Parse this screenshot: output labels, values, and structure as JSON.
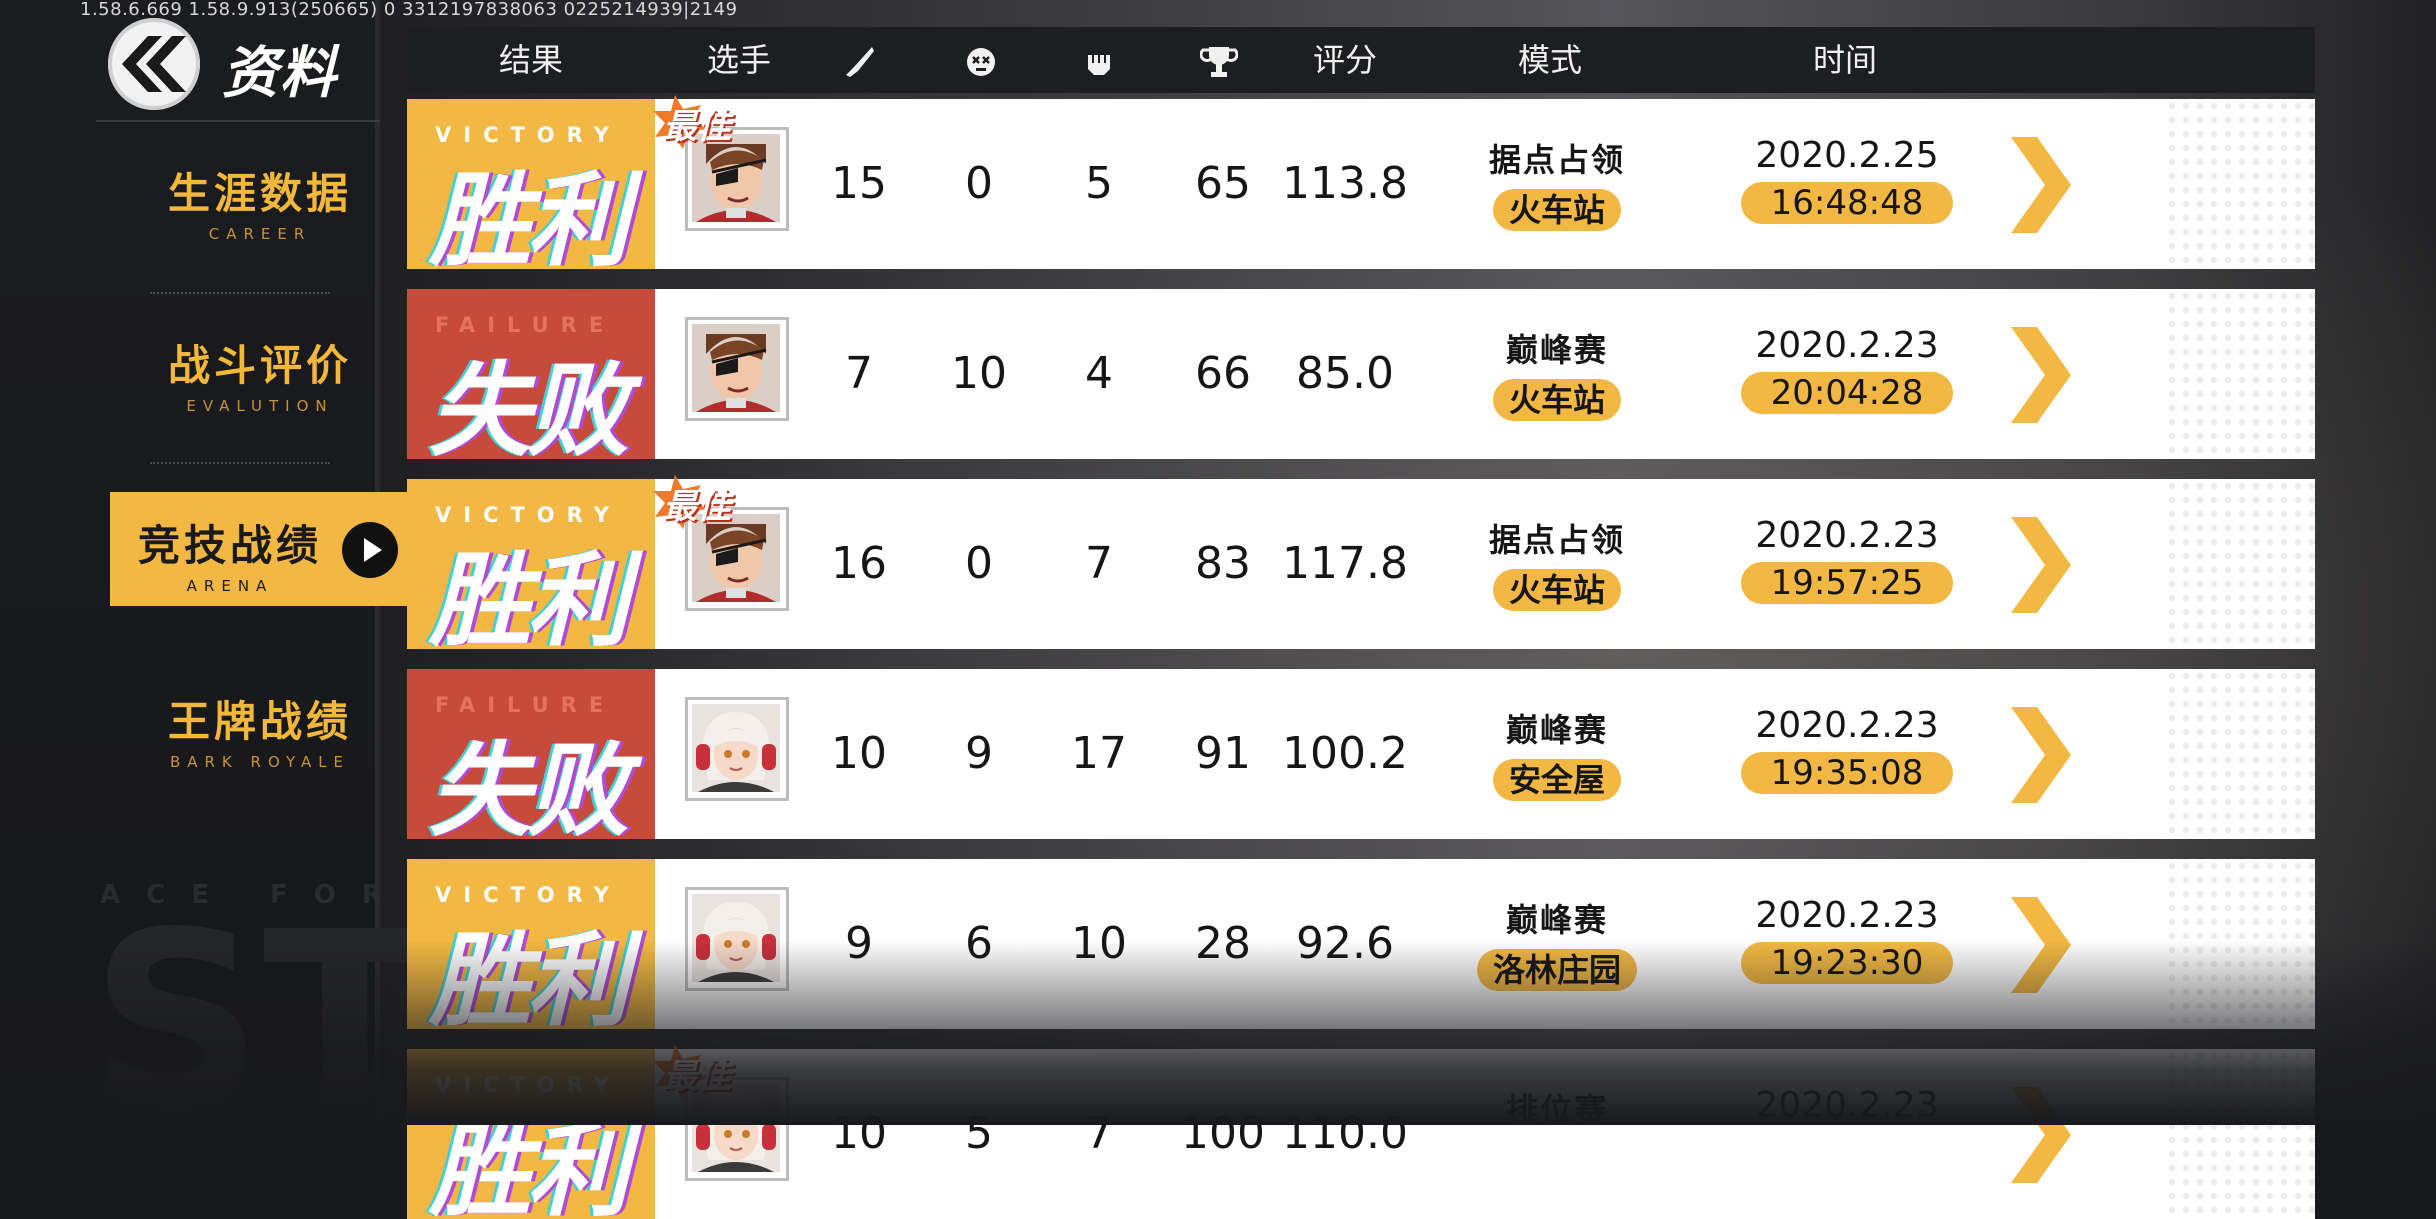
{
  "debug_text": "1.58.6.669 1.58.9.913(250665) 0 3312197838063   0225214939|2149",
  "app": {
    "title": "资料",
    "back_icon": "double-chevron-left-icon"
  },
  "sidebar": {
    "items": [
      {
        "label": "生涯数据",
        "sub": "CAREER",
        "active": false
      },
      {
        "label": "战斗评价",
        "sub": "EVALUTION",
        "active": false
      },
      {
        "label": "竞技战绩",
        "sub": "ARENA",
        "active": true
      },
      {
        "label": "王牌战绩",
        "sub": "BARK ROYALE",
        "active": false
      }
    ],
    "watermark_sub": "ACE FORCE",
    "watermark_big": "ST"
  },
  "table": {
    "headers": {
      "result": "结果",
      "player": "选手",
      "kills_icon": "knife-icon",
      "deaths_icon": "skull-icon",
      "assists_icon": "fist-icon",
      "points_icon": "trophy-icon",
      "score": "评分",
      "mode": "模式",
      "time": "时间"
    },
    "best_badge": "最佳",
    "rows": [
      {
        "result": "win",
        "result_en": "VICTORY",
        "result_cn": "胜利",
        "best": true,
        "avatar": "eyepatch-hero",
        "kills": "15",
        "deaths": "0",
        "assists": "5",
        "points": "65",
        "score": "113.8",
        "mode": "据点占领",
        "map": "火车站",
        "date": "2020.2.25",
        "time": "16:48:48"
      },
      {
        "result": "lose",
        "result_en": "FAILURE",
        "result_cn": "失败",
        "best": false,
        "avatar": "eyepatch-hero",
        "kills": "7",
        "deaths": "10",
        "assists": "4",
        "points": "66",
        "score": "85.0",
        "mode": "巅峰赛",
        "map": "火车站",
        "date": "2020.2.23",
        "time": "20:04:28"
      },
      {
        "result": "win",
        "result_en": "VICTORY",
        "result_cn": "胜利",
        "best": true,
        "avatar": "eyepatch-hero",
        "kills": "16",
        "deaths": "0",
        "assists": "7",
        "points": "83",
        "score": "117.8",
        "mode": "据点占领",
        "map": "火车站",
        "date": "2020.2.23",
        "time": "19:57:25"
      },
      {
        "result": "lose",
        "result_en": "FAILURE",
        "result_cn": "失败",
        "best": false,
        "avatar": "headphone-girl",
        "kills": "10",
        "deaths": "9",
        "assists": "17",
        "points": "91",
        "score": "100.2",
        "mode": "巅峰赛",
        "map": "安全屋",
        "date": "2020.2.23",
        "time": "19:35:08"
      },
      {
        "result": "win",
        "result_en": "VICTORY",
        "result_cn": "胜利",
        "best": false,
        "avatar": "headphone-girl",
        "kills": "9",
        "deaths": "6",
        "assists": "10",
        "points": "28",
        "score": "92.6",
        "mode": "巅峰赛",
        "map": "洛林庄园",
        "date": "2020.2.23",
        "time": "19:23:30"
      },
      {
        "result": "win",
        "result_en": "VICTORY",
        "result_cn": "胜利",
        "best": true,
        "avatar": "headphone-girl",
        "kills": "10",
        "deaths": "5",
        "assists": "7",
        "points": "100",
        "score": "110.0",
        "mode": "排位赛",
        "map": "",
        "date": "2020.2.23",
        "time": ""
      }
    ]
  },
  "colors": {
    "accent": "#f2b843",
    "failure": "#c84a3a",
    "header_bg": "#1d1e21"
  }
}
